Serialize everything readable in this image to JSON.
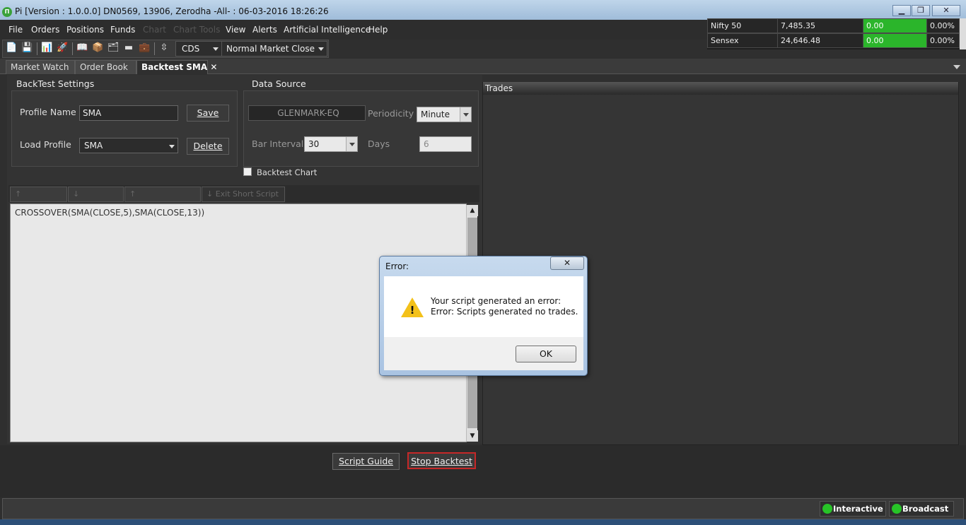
{
  "window": {
    "title": "Pi [Version : 1.0.0.0] DN0569, 13906, Zerodha -All- : 06-03-2016 18:26:26",
    "app_icon": "Π",
    "controls": {
      "minimize": "▁",
      "maximize": "❐",
      "close": "✕"
    }
  },
  "menu": {
    "items": [
      "File",
      "Orders",
      "Positions",
      "Funds",
      "Chart",
      "Chart Tools",
      "View",
      "Alerts",
      "Artificial Intelligence",
      "Help"
    ],
    "disabled": [
      "Chart",
      "Chart Tools"
    ]
  },
  "toolbar": {
    "icons": [
      "📄",
      "💾",
      "📊",
      "🚀",
      "📖",
      "📦",
      "🗂",
      "▬",
      "💼",
      "⇳"
    ],
    "exchange": "CDS",
    "market_status": "Normal Market Close"
  },
  "ticker": [
    {
      "name": "Nifty 50",
      "value": "7,485.35",
      "change": "0.00",
      "pct": "0.00%"
    },
    {
      "name": "Sensex",
      "value": "24,646.48",
      "change": "0.00",
      "pct": "0.00%"
    }
  ],
  "tabs": [
    {
      "label": "Market Watch"
    },
    {
      "label": "Order Book"
    },
    {
      "label": "Backtest SMA ✕"
    }
  ],
  "backtest_settings": {
    "title": "BackTest Settings",
    "profile_name_label": "Profile Name",
    "profile_name_value": "SMA",
    "save_label": "Save",
    "load_profile_label": "Load Profile",
    "load_profile_value": "SMA",
    "delete_label": "Delete"
  },
  "data_source": {
    "title": "Data Source",
    "symbol": "GLENMARK-EQ",
    "periodicity_label": "Periodicity",
    "periodicity_value": "Minute",
    "bar_interval_label": "Bar Interval",
    "bar_interval_value": "30",
    "days_label": "Days",
    "days_value": "6"
  },
  "backtest_chart_label": "Backtest Chart",
  "script_tabs": [
    "",
    "",
    "",
    "Exit Short Script"
  ],
  "script_tab_icons": [
    "↑",
    "↓",
    "↑",
    "↓"
  ],
  "script_text": "CROSSOVER(SMA(CLOSE,5),SMA(CLOSE,13))",
  "trades_title": "Trades",
  "buttons": {
    "script_guide": "Script Guide",
    "stop_backtest": "Stop Backtest"
  },
  "status": {
    "interactive": "Interactive",
    "broadcast": "Broadcast"
  },
  "dialog": {
    "title": "Error:",
    "close": "✕",
    "line1": "Your script generated an error:",
    "line2": "Error: Scripts generated no trades.",
    "ok": "OK",
    "warn_mark": "!"
  }
}
